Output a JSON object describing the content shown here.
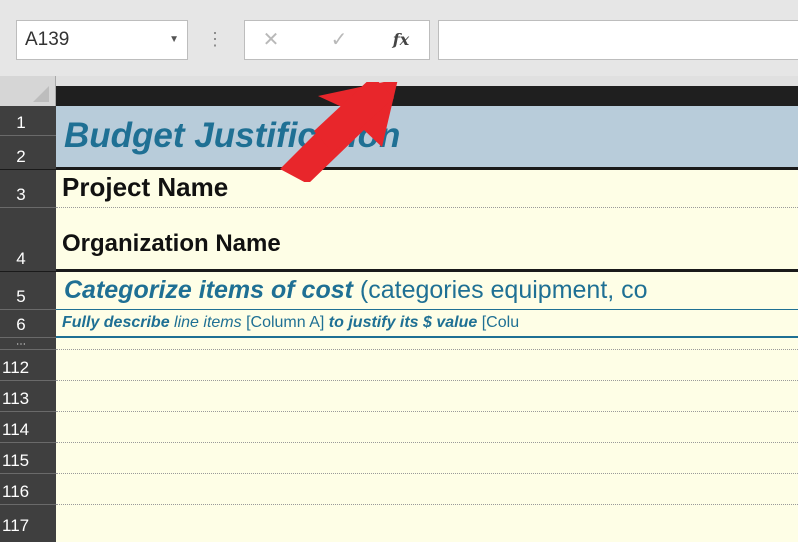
{
  "formula_bar": {
    "name_box": "A139",
    "cancel_symbol": "✕",
    "enter_symbol": "✓",
    "fx_symbol": "fx",
    "options_symbol": "⋮",
    "formula_value": ""
  },
  "rows": {
    "headers": [
      "1",
      "2",
      "3",
      "4",
      "5",
      "6",
      "112",
      "113",
      "114",
      "115",
      "116",
      "117"
    ],
    "hidden_indicator": "⋯"
  },
  "sheet": {
    "title": "Budget Justification",
    "project_name": "Project Name",
    "organization_name": "Organization Name",
    "categorize": {
      "emphasis": "Categorize items of cost",
      "rest": "(categories equipment, co"
    },
    "describe": {
      "part1": "Fully describe",
      "part2": "line items",
      "part3": "[Column A]",
      "part4": "to justify its $ value",
      "part5": "[Colu"
    }
  },
  "colors": {
    "title_blue": "#1f7094",
    "title_band": "#b8ccda",
    "cream": "#fefee6",
    "row_header": "#3f3f3f",
    "arrow_red": "#e8262b"
  },
  "annotation": {
    "arrow_icon": "red-arrow-icon"
  }
}
